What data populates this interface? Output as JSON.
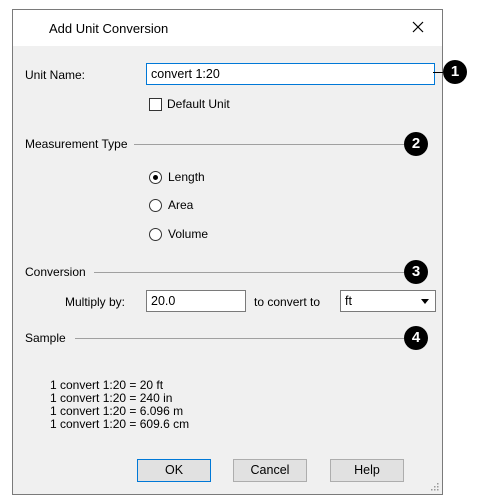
{
  "dialog": {
    "title": "Add Unit Conversion",
    "close_icon": "close-icon"
  },
  "unit_name": {
    "label": "Unit Name:",
    "value": "convert 1:20",
    "default_unit_label": "Default Unit",
    "default_unit_checked": false
  },
  "measurement_type": {
    "heading": "Measurement Type",
    "options": [
      {
        "label": "Length",
        "selected": true
      },
      {
        "label": "Area",
        "selected": false
      },
      {
        "label": "Volume",
        "selected": false
      }
    ]
  },
  "conversion": {
    "heading": "Conversion",
    "multiply_label": "Multiply by:",
    "multiply_value": "20.0",
    "convert_label": "to convert to",
    "unit_selected": "ft"
  },
  "sample": {
    "heading": "Sample",
    "lines": [
      "1 convert 1:20 = 20 ft",
      "1 convert 1:20 = 240 in",
      "1 convert 1:20 = 6.096 m",
      "1 convert 1:20 = 609.6 cm"
    ]
  },
  "buttons": {
    "ok": "OK",
    "cancel": "Cancel",
    "help": "Help"
  },
  "callouts": [
    "1",
    "2",
    "3",
    "4"
  ],
  "colors": {
    "focus_border": "#0078d7",
    "client_background": "#f0f0f0",
    "callout": "#000000"
  }
}
